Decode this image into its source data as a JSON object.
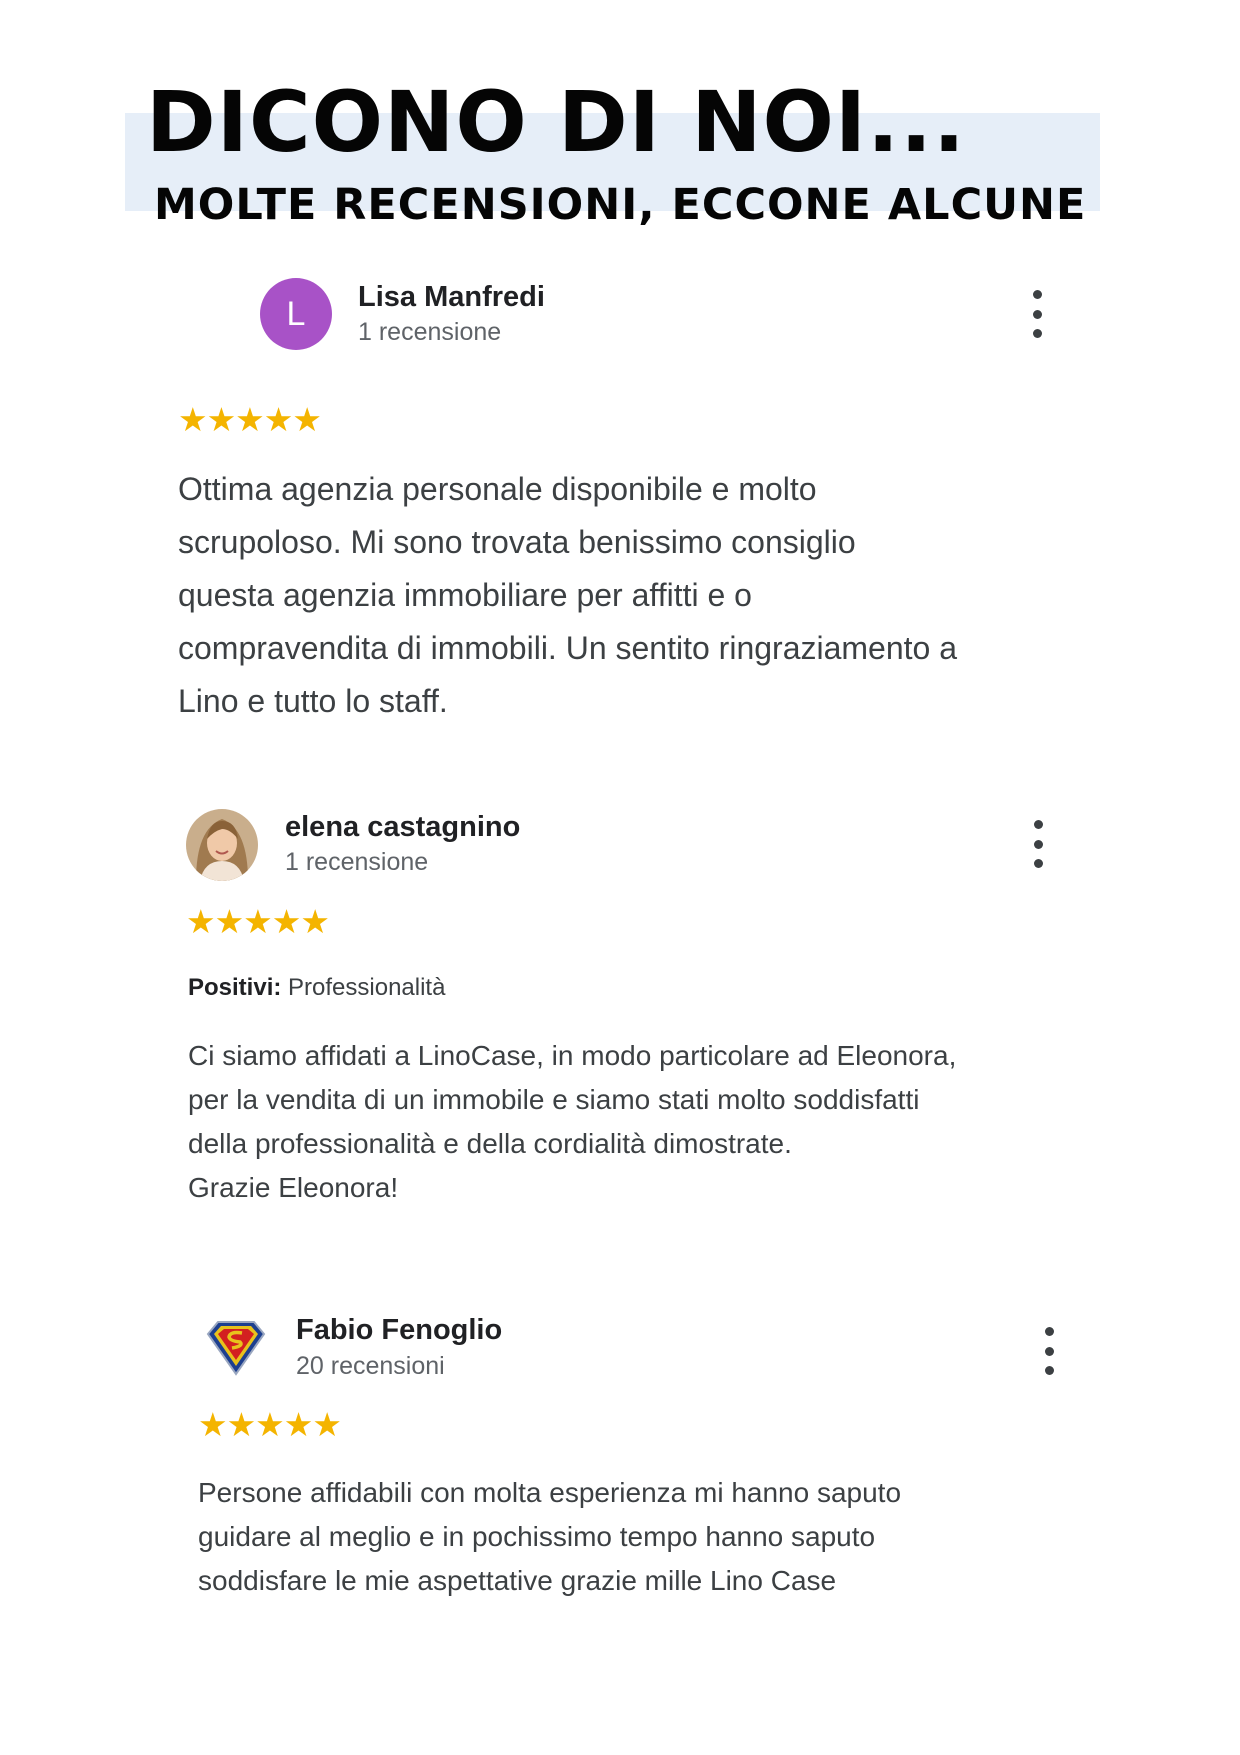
{
  "header": {
    "title": "DICONO DI NOI...",
    "subtitle": "MOLTE RECENSIONI, ECCONE ALCUNE"
  },
  "colors": {
    "header_band": "#e6eef8",
    "star": "#f4b400",
    "avatar_lisa": "#a852c7"
  },
  "reviews": [
    {
      "name": "Lisa Manfredi",
      "count": "1 recensione",
      "avatar_letter": "L",
      "rating": "★★★★★",
      "text": "Ottima agenzia personale disponibile e molto\nscrupoloso. Mi sono trovata benissimo consiglio\nquesta agenzia immobiliare per affitti e o\ncompravendita di immobili. Un sentito ringraziamento a\nLino e tutto lo staff."
    },
    {
      "name": "elena castagnino",
      "count": "1 recensione",
      "avatar_icon": "profile-photo",
      "rating": "★★★★★",
      "positive_label": "Positivi:",
      "positive_value": " Professionalità",
      "text": "Ci siamo affidati a LinoCase, in modo particolare ad Eleonora,\nper la vendita di un immobile e siamo stati molto soddisfatti\ndella professionalità e della cordialità dimostrate.\nGrazie Eleonora!"
    },
    {
      "name": "Fabio Fenoglio",
      "count": "20 recensioni",
      "avatar_icon": "superman-shield-icon",
      "rating": "★★★★★",
      "text": "Persone affidabili con molta esperienza mi hanno saputo\nguidare al meglio e in pochissimo tempo hanno saputo\nsoddisfare le mie aspettative grazie mille Lino Case"
    }
  ]
}
